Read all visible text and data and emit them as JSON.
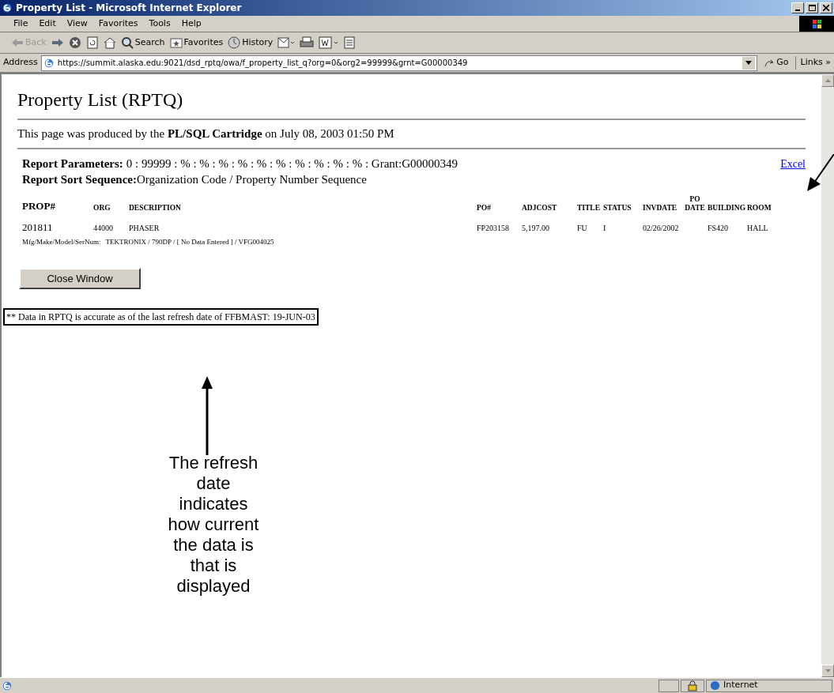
{
  "window": {
    "title": "Property List - Microsoft Internet Explorer"
  },
  "menu": [
    "File",
    "Edit",
    "View",
    "Favorites",
    "Tools",
    "Help"
  ],
  "toolbar": [
    {
      "kind": "back",
      "label": "Back",
      "disabled": true
    },
    {
      "kind": "forward"
    },
    {
      "kind": "stop"
    },
    {
      "kind": "refresh"
    },
    {
      "kind": "home"
    },
    {
      "kind": "search",
      "label": "Search"
    },
    {
      "kind": "favorites",
      "label": "Favorites"
    },
    {
      "kind": "history",
      "label": "History"
    },
    {
      "kind": "mail"
    },
    {
      "kind": "print"
    },
    {
      "kind": "edit"
    },
    {
      "kind": "discuss"
    }
  ],
  "address": {
    "label": "Address",
    "url": "https://summit.alaska.edu:9021/dsd_rptq/owa/f_property_list_q?org=0&org2=99999&grnt=G00000349",
    "go": "Go",
    "links": "Links »"
  },
  "page": {
    "heading": "Property List (RPTQ)",
    "produced": "This page was produced by the **PL/SQL Cartridge** on July 08, 2003 01:50 PM",
    "params_label": "Report Parameters:",
    "params_value": "0 : 99999 : % : % : % : % : % : % : % : % : % : % : Grant:G00000349",
    "sort_label": "Report Sort Sequence:",
    "sort_value": "Organization Code / Property Number Sequence",
    "excel": "Excel",
    "columns": [
      "PROP#",
      "ORG",
      "DESCRIPTION",
      "PO#",
      "ADJCOST",
      "TITLE",
      "STATUS",
      "INVDATE",
      "PO DATE",
      "BUILDING",
      "ROOM"
    ],
    "rows": [
      {
        "cells": [
          "201811",
          "44000",
          "PHASER",
          "FP203158",
          "5,197.00",
          "FU",
          "I",
          "02/26/2002",
          "",
          "FS420",
          "HALL"
        ],
        "detail_label": "Mfg/Make/Model/SerNum:",
        "detail_value": "TEKTRONIX / 790DP / [ No Data Entered ] / VFG004025"
      }
    ],
    "close_button": "Close Window",
    "note": "** Data in RPTQ is accurate as of the last refresh date of FFBMAST: 19-JUN-03"
  },
  "annotation": {
    "lines": [
      "The refresh",
      "date",
      "indicates",
      "how current",
      "the data is",
      "that is",
      "displayed"
    ]
  },
  "status_bar": {
    "zone": "Internet"
  }
}
